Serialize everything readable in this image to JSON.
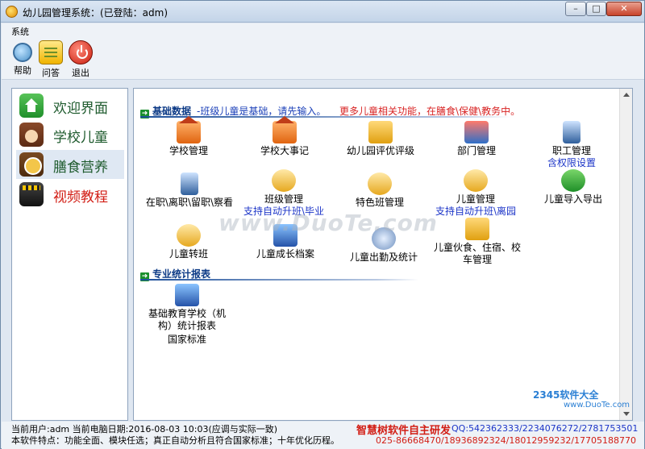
{
  "window": {
    "title": "幼儿园管理系统：(已登陆：adm)"
  },
  "menu": {
    "system": "系统"
  },
  "toolbar": {
    "help": "帮助",
    "qa": "问答",
    "exit": "退出"
  },
  "sidebar": {
    "items": [
      {
        "label": "欢迎界面",
        "icon": "home-icon"
      },
      {
        "label": "学校儿童",
        "icon": "child-icon"
      },
      {
        "label": "膳食营养",
        "icon": "food-icon"
      },
      {
        "label": "视频教程",
        "icon": "video-icon"
      }
    ]
  },
  "main": {
    "section1": {
      "title": "基础数据",
      "note_blue": "-班级儿童是基础，请先输入。",
      "note_red": "更多儿童相关功能，在膳食\\保健\\教务中。"
    },
    "tiles": {
      "school_mgmt": "学校管理",
      "school_events": "学校大事记",
      "evaluation": "幼儿园评优评级",
      "dept_mgmt": "部门管理",
      "staff_mgmt": "职工管理",
      "staff_sub": "含权限设置",
      "staff_status": "在职\\离职\\留职\\察看",
      "class_mgmt": "班级管理",
      "class_sub": "支持自动升班\\毕业",
      "special_class": "特色班管理",
      "child_mgmt": "儿童管理",
      "child_sub": "支持自动升班\\离园",
      "child_import": "儿童导入导出",
      "child_transfer": "儿童转班",
      "growth_archive": "儿童成长档案",
      "attendance": "儿童出勤及统计",
      "meals": "儿童伙食、住宿、校车管理"
    },
    "section2": {
      "title": "专业统计报表"
    },
    "report": {
      "label": "基础教育学校（机构）统计报表",
      "sub": "国家标准"
    },
    "watermark": "www.DuoTe.com"
  },
  "status": {
    "line1": "当前用户:adm 当前电脑日期:2016-08-03 10:03(应调与实际一致)",
    "line2": "本软件特点：功能全面、模块任选；真正自动分析且符合国家标准；十年优化历程。",
    "brand": "智慧树软件自主研发",
    "qq": "QQ:542362333/2234076272/2781753501",
    "phones": "025-86668470/18936892324/18012959232/17705188770"
  },
  "corner_logo": {
    "name": "2345软件大全",
    "url": "www.DuoTe.com"
  }
}
